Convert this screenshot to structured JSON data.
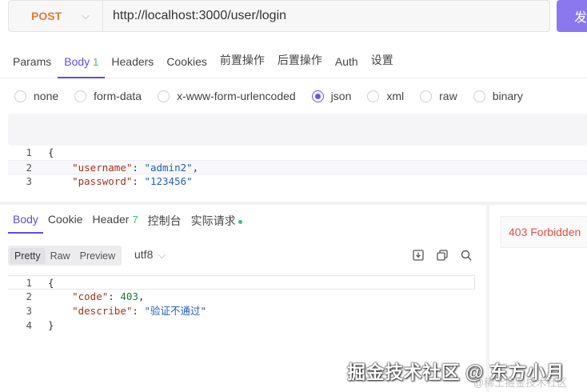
{
  "request": {
    "method": "POST",
    "url": "http://localhost:3000/user/login",
    "send_label": "发"
  },
  "req_tabs": [
    {
      "label": "Params"
    },
    {
      "label": "Body",
      "badge": "1"
    },
    {
      "label": "Headers"
    },
    {
      "label": "Cookies"
    },
    {
      "label": "前置操作"
    },
    {
      "label": "后置操作"
    },
    {
      "label": "Auth"
    },
    {
      "label": "设置"
    }
  ],
  "active_req_tab": "Body",
  "body_types": [
    "none",
    "form-data",
    "x-www-form-urlencoded",
    "json",
    "xml",
    "raw",
    "binary"
  ],
  "selected_body_type": "json",
  "request_body_lines": [
    {
      "n": "1",
      "text": "{"
    },
    {
      "n": "2",
      "key": "\"username\"",
      "value": "\"admin2\"",
      "suffix": ","
    },
    {
      "n": "3",
      "key": "\"password\"",
      "value": "\"123456\"",
      "suffix": ""
    }
  ],
  "resp_tabs": [
    {
      "label": "Body"
    },
    {
      "label": "Cookie"
    },
    {
      "label": "Header",
      "badge": "7"
    },
    {
      "label": "控制台"
    },
    {
      "label": "实际请求"
    }
  ],
  "active_resp_tab": "Body",
  "view_modes": [
    "Pretty",
    "Raw",
    "Preview"
  ],
  "active_view_mode": "Pretty",
  "encoding": "utf8",
  "response_lines": [
    {
      "n": "1",
      "text": "{"
    },
    {
      "n": "2",
      "key": "\"code\"",
      "value": "403",
      "suffix": ","
    },
    {
      "n": "3",
      "key": "\"describe\"",
      "value": "\"验证不通过\"",
      "suffix": ""
    },
    {
      "n": "4",
      "text": "}"
    }
  ],
  "status": "403 Forbidden",
  "watermark": {
    "main": "掘金技术社区 @ 东方小月",
    "sub": "@稀土掘金技术社区"
  },
  "colors": {
    "accent": "#5f4ce6",
    "method": "#e07c3a",
    "send": "#8b78ee",
    "status_error": "#e0504a",
    "badge_green": "#3fbf6f"
  },
  "icons": [
    "chevron-down-icon",
    "download-icon",
    "copy-icon",
    "search-icon"
  ]
}
